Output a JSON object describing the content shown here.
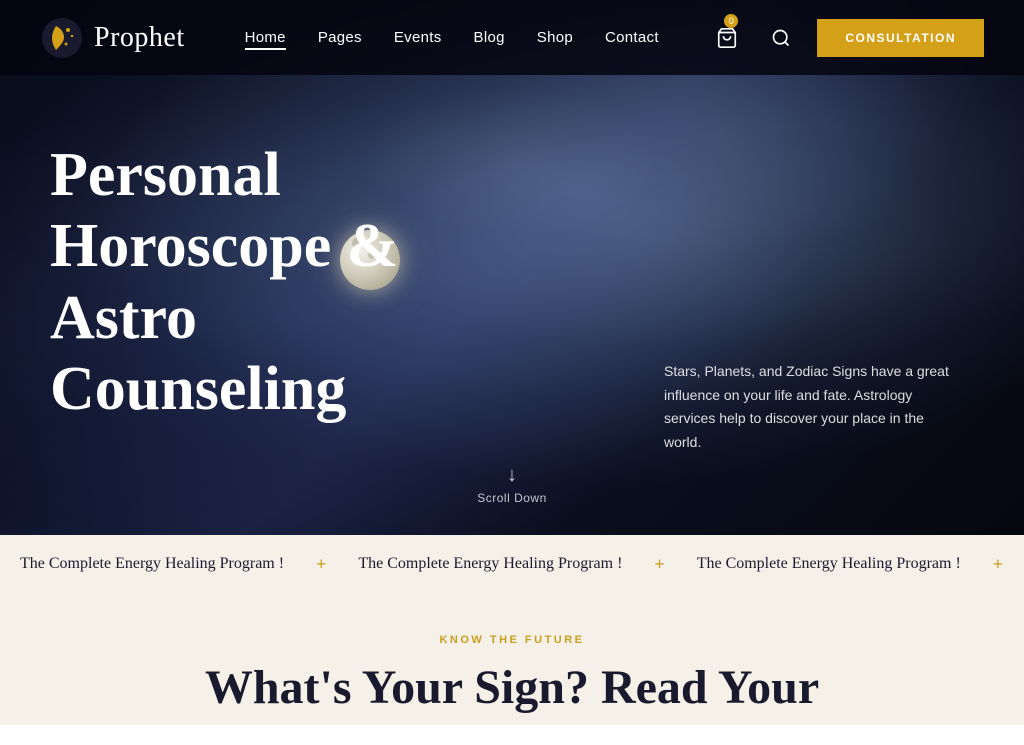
{
  "brand": {
    "name": "Prophet"
  },
  "navbar": {
    "links": [
      {
        "label": "Home",
        "active": true
      },
      {
        "label": "Pages",
        "active": false
      },
      {
        "label": "Events",
        "active": false
      },
      {
        "label": "Blog",
        "active": false
      },
      {
        "label": "Shop",
        "active": false
      },
      {
        "label": "Contact",
        "active": false
      }
    ],
    "consultation_label": "CONSULTATION"
  },
  "hero": {
    "title": "Personal Horoscope & Astro Counseling",
    "description": "Stars, Planets, and Zodiac Signs have a great influence on your life and fate. Astrology services help to discover your place in the world.",
    "scroll_label": "Scroll Down"
  },
  "ticker": {
    "text": "The Complete Energy Healing Program !",
    "items": [
      "The Complete Energy Healing Program !",
      "The Complete Energy Healing Program !",
      "The Complete Energy Healing Program !",
      "The Complete Energy Healing Program !"
    ]
  },
  "section": {
    "eyebrow": "KNOW THE FUTURE",
    "heading_partial": "What's Your Sign? Read Your"
  },
  "colors": {
    "accent_gold": "#d4a017",
    "dark_bg": "#0a0c1a",
    "light_bg": "#f5f0e8"
  }
}
